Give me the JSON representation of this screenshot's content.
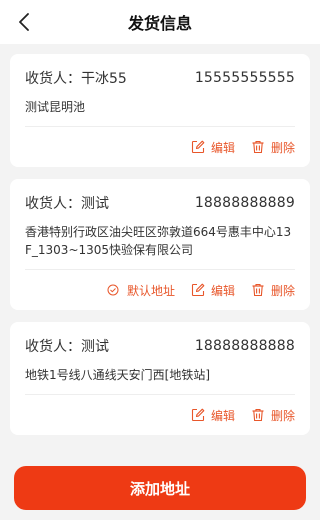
{
  "header": {
    "title": "发货信息"
  },
  "labels": {
    "receiver_prefix": "收货人：",
    "edit": "编辑",
    "delete": "删除",
    "set_default": "默认地址"
  },
  "addresses": [
    {
      "name": "干冰55",
      "phone": "15555555555",
      "address": "测试昆明池",
      "show_default": false
    },
    {
      "name": "测试",
      "phone": "18888888889",
      "address": "香港特别行政区油尖旺区弥敦道664号惠丰中心13F_1303~1305快验保有限公司",
      "show_default": true
    },
    {
      "name": "测试",
      "phone": "18888888888",
      "address": "地铁1号线八通线天安门西[地铁站]",
      "show_default": false
    }
  ],
  "add_button": {
    "label": "添加地址"
  },
  "colors": {
    "accent": "#e8562a",
    "button": "#ee3a14"
  }
}
